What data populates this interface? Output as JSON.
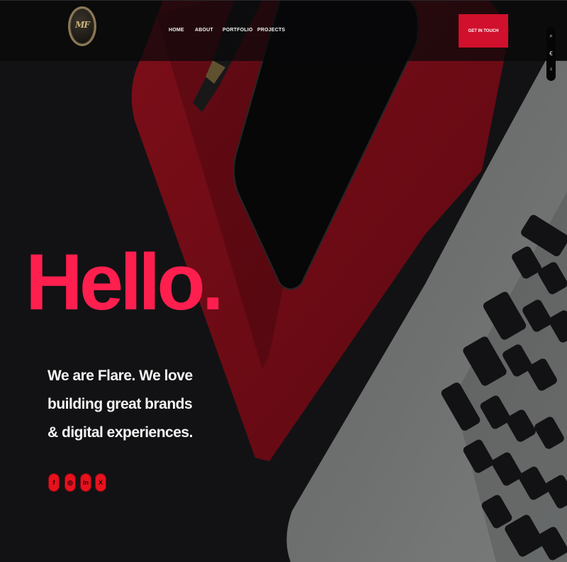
{
  "header": {
    "logo_text": "MF",
    "nav": [
      {
        "label": "HOME"
      },
      {
        "label": "ABOUT"
      },
      {
        "label": "PORTFOLIO"
      },
      {
        "label": "PROJECTS"
      }
    ],
    "cta_label": "GET IN TOUCH"
  },
  "side_tools": [
    "search-icon",
    "euro-icon",
    "bulb-icon"
  ],
  "hero": {
    "headline": "Hello.",
    "tagline": "We are Flare. We love building great brands & digital experiences."
  },
  "social": [
    {
      "icon": "facebook-icon",
      "glyph": "f"
    },
    {
      "icon": "instagram-icon",
      "glyph": "◎"
    },
    {
      "icon": "linkedin-icon",
      "glyph": "in"
    },
    {
      "icon": "x-icon",
      "glyph": "X"
    }
  ],
  "colors": {
    "accent": "#ff1f4e",
    "cta": "#d0102c",
    "social": "#e8111e",
    "background": "#141416"
  }
}
